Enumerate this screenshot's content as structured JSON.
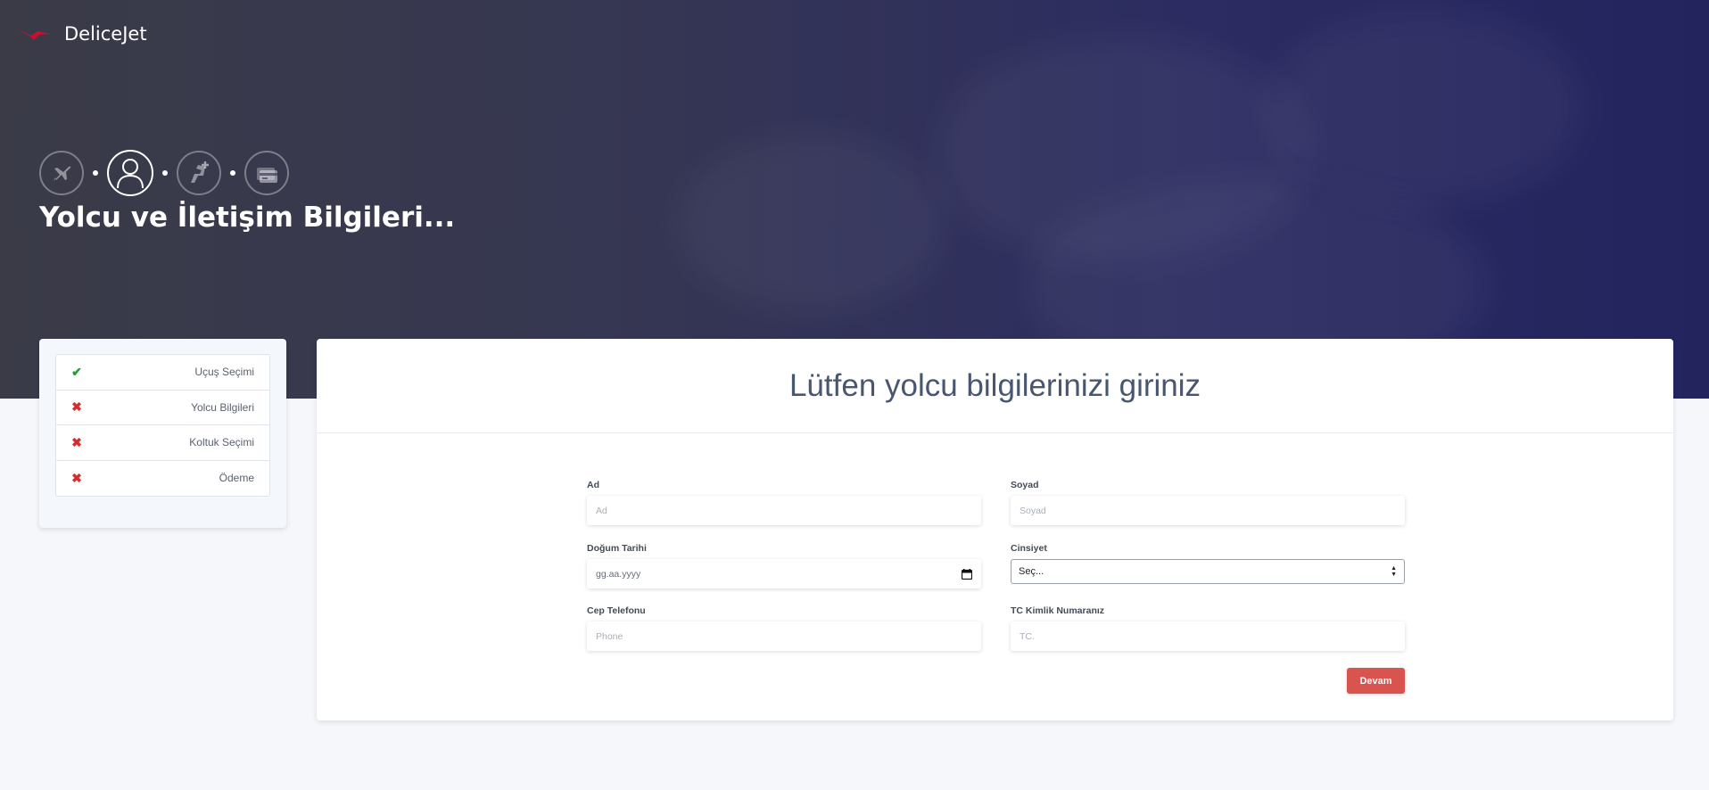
{
  "brand": {
    "name": "DeliceJet"
  },
  "steps": [
    {
      "icon": "airplane-icon"
    },
    {
      "icon": "user-icon"
    },
    {
      "icon": "seat-plus-icon"
    },
    {
      "icon": "credit-card-icon"
    }
  ],
  "hero": {
    "title": "Yolcu ve İletişim Bilgileri..."
  },
  "sidebar": {
    "items": [
      {
        "mark": "✔",
        "label": "Uçuş Seçimi",
        "status": "done"
      },
      {
        "mark": "✖",
        "label": "Yolcu Bilgileri",
        "status": "pending"
      },
      {
        "mark": "✖",
        "label": "Koltuk Seçimi",
        "status": "pending"
      },
      {
        "mark": "✖",
        "label": "Ödeme",
        "status": "pending"
      }
    ]
  },
  "form": {
    "title": "Lütfen yolcu bilgilerinizi giriniz",
    "ad": {
      "label": "Ad",
      "placeholder": "Ad"
    },
    "soyad": {
      "label": "Soyad",
      "placeholder": "Soyad"
    },
    "dogum": {
      "label": "Doğum Tarihi",
      "placeholder": "gg.aa.yyyy"
    },
    "cinsiyet": {
      "label": "Cinsiyet",
      "value": "Seç..."
    },
    "telefon": {
      "label": "Cep Telefonu",
      "placeholder": "Phone"
    },
    "tc": {
      "label": "TC Kimlik Numaranız",
      "placeholder": "TC."
    },
    "submit_label": "Devam"
  },
  "colors": {
    "accent": "#d9534f",
    "done": "#1c9d3a",
    "pending": "#d22f2f",
    "title": "#485671"
  }
}
